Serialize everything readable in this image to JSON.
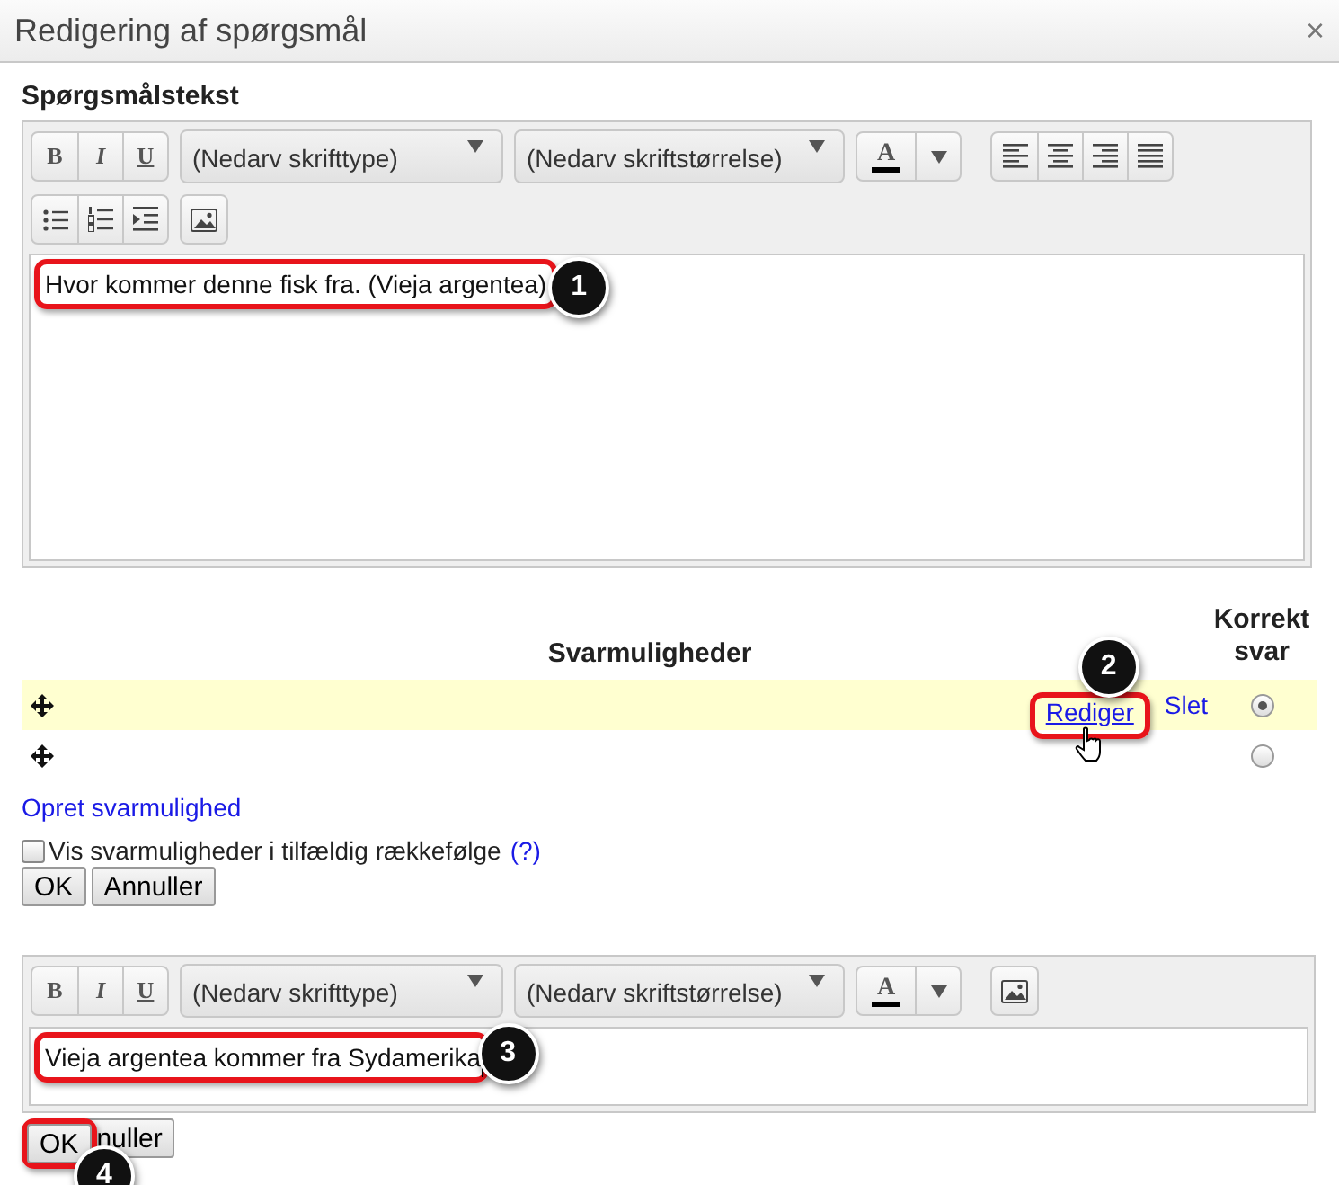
{
  "dialog": {
    "title": "Redigering af spørgsmål",
    "close": "×"
  },
  "question": {
    "label": "Spørgsmålstekst",
    "toolbar": [
      {
        "kind": "format",
        "labels": [
          "B",
          "I",
          "U"
        ]
      },
      {
        "kind": "select",
        "value": "(Nedarv skrifttype)"
      },
      {
        "kind": "select",
        "value": "(Nedarv skriftstørrelse)"
      },
      {
        "kind": "color",
        "label": "A"
      },
      {
        "kind": "align"
      },
      {
        "kind": "break"
      },
      {
        "kind": "lists"
      },
      {
        "kind": "image"
      }
    ],
    "text": "Hvor kommer denne fisk fra. (Vieja argentea)",
    "callout": "1"
  },
  "answers": {
    "header": "Svarmuligheder",
    "correct_header": "Korrekt svar",
    "rows": [
      {
        "selected": true,
        "correct": true,
        "actions": [
          "Rediger",
          "Slet"
        ],
        "callout": "2"
      },
      {
        "selected": false,
        "correct": false
      }
    ],
    "add_link": "Opret svarmulighed",
    "random_order": {
      "label": "Vis svarmuligheder i tilfældig rækkefølge",
      "help": "(?)",
      "checked": false
    },
    "buttons": [
      "OK",
      "Annuller"
    ]
  },
  "answer_editor": {
    "toolbar": [
      {
        "kind": "format",
        "labels": [
          "B",
          "I",
          "U"
        ]
      },
      {
        "kind": "select",
        "value": "(Nedarv skrifttype)"
      },
      {
        "kind": "select",
        "value": "(Nedarv skriftstørrelse)"
      },
      {
        "kind": "color",
        "label": "A"
      },
      {
        "kind": "image"
      }
    ],
    "text": "Vieja argentea kommer fra Sydamerika",
    "callout": "3",
    "buttons": [
      {
        "label": "OK",
        "callout": "4"
      },
      {
        "label": "nuller"
      }
    ]
  }
}
